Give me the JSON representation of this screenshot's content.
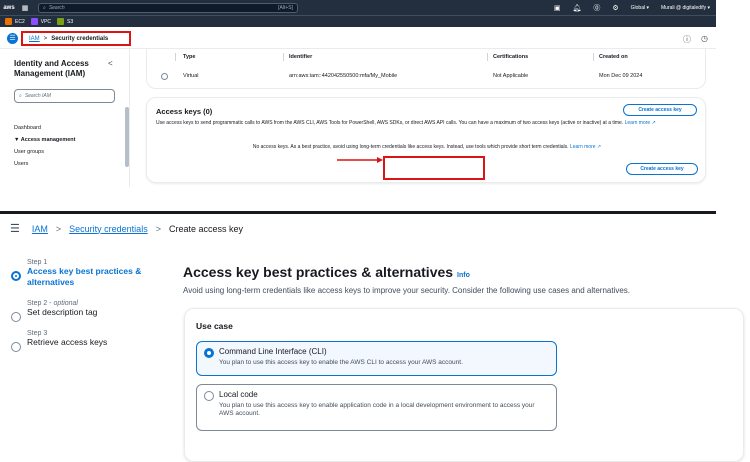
{
  "topnav": {
    "logo": "aws",
    "search_placeholder": "Search",
    "search_shortcut": "[Alt+S]",
    "region": "Global ▾",
    "account": "Murali @ digitaledify ▾"
  },
  "servicebar": [
    {
      "label": "EC2",
      "color": "#ed7100"
    },
    {
      "label": "VPC",
      "color": "#8c4fff"
    },
    {
      "label": "S3",
      "color": "#7aa116"
    }
  ],
  "upper": {
    "breadcrumb": {
      "root": "IAM",
      "current": "Security credentials"
    },
    "sidebar": {
      "title": "Identity and Access Management (IAM)",
      "search_placeholder": "Search IAM",
      "items": [
        "Dashboard",
        "▼ Access management",
        "User groups",
        "Users"
      ]
    },
    "mfa_table": {
      "columns": [
        "Type",
        "Identifier",
        "Certifications",
        "Created on"
      ],
      "row": {
        "type": "Virtual",
        "identifier": "arn:aws:iam::442042550500:mfa/My_Mobile",
        "certifications": "Not Applicable",
        "created": "Mon Dec 09 2024"
      }
    },
    "access_keys": {
      "title": "Access keys (0)",
      "create_label": "Create access key",
      "description": "Use access keys to send programmatic calls to AWS from the AWS CLI, AWS Tools for PowerShell, AWS SDKs, or direct AWS API calls. You can have a maximum of two access keys (active or inactive) at a time.",
      "learn_more": "Learn more",
      "empty_text": "No access keys. As a best practice, avoid using long-term credentials like access keys. Instead, use tools which provide short term credentials.",
      "empty_learn_more": "Learn more",
      "center_button": "Create access key"
    }
  },
  "lower": {
    "breadcrumb": {
      "root": "IAM",
      "middle": "Security credentials",
      "current": "Create access key"
    },
    "steps": [
      {
        "num": "Step 1",
        "optional": "",
        "label": "Access key best practices & alternatives"
      },
      {
        "num": "Step 2 -",
        "optional": "optional",
        "label": "Set description tag"
      },
      {
        "num": "Step 3",
        "optional": "",
        "label": "Retrieve access keys"
      }
    ],
    "title": "Access key best practices & alternatives",
    "info": "Info",
    "subtitle": "Avoid using long-term credentials like access keys to improve your security. Consider the following use cases and alternatives.",
    "use_case": {
      "title": "Use case",
      "options": [
        {
          "title": "Command Line Interface (CLI)",
          "desc": "You plan to use this access key to enable the AWS CLI to access your AWS account.",
          "selected": true
        },
        {
          "title": "Local code",
          "desc": "You plan to use this access key to enable application code in a local development environment to access your AWS account.",
          "selected": false
        }
      ]
    }
  },
  "colors": {
    "accent": "#0972d3",
    "highlight": "#d91515",
    "nav": "#232f3e"
  }
}
